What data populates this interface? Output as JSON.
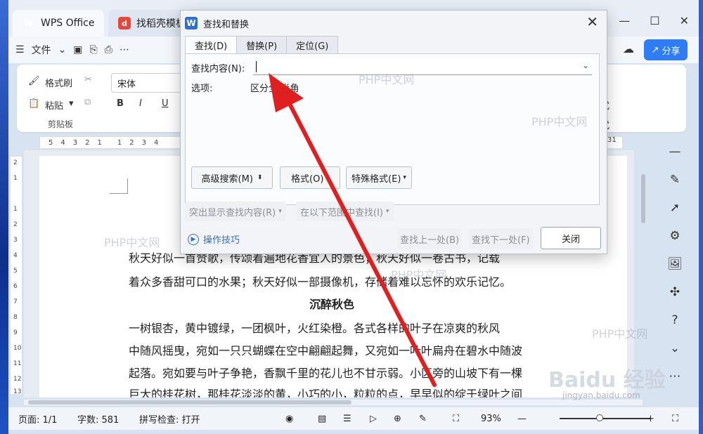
{
  "titlebar": {
    "tabs": [
      {
        "label": "WPS Office"
      },
      {
        "label": "找稻壳模板"
      }
    ],
    "share_label": "分享"
  },
  "toolbar": {
    "file_menu": "文件"
  },
  "ribbon": {
    "format_painter": "格式刷",
    "paste": "粘贴",
    "clipboard_group": "剪贴板",
    "font_name": "宋体",
    "bold": "B",
    "italic": "I",
    "underline": "U"
  },
  "ruler": {
    "ticks": [
      "5",
      "4",
      "3",
      "2",
      "1",
      "",
      "1",
      "2",
      "3",
      "4"
    ],
    "right_tick": "31",
    "vticks": [
      "2",
      "1",
      "",
      "1",
      "2",
      "3",
      "4",
      "5",
      "6",
      "7",
      "8",
      "9",
      "10",
      "11",
      "12",
      "13"
    ]
  },
  "document": {
    "para1_line1": "秋天好似一首赞歌，传颂着遍地花香宜人的景色；秋天好似一卷古书，记载",
    "para1_line2": "着众多香甜可口的水果；秋天好似一部摄像机，存储着难以忘怀的欢乐记忆。",
    "heading": "沉醉秋色",
    "para2_line1": "一树银杏，黄中镀绿，一团枫叶，火红染橙。各式各样的叶子在凉爽的秋风",
    "para2_line2": "中随风摇曳，宛如一只只蝴蝶在空中翩翩起舞，又宛如一叶叶扁舟在碧水中随波",
    "para2_line3": "起落。宛如要与叶子争艳，香飘千里的花儿也不甘示弱。小区旁的山坡下有一棵",
    "para2_line4": "巨大的桂花树，那桂花淡淡的黄，小巧的小，粒粒的点，早早似的绽于绿叶之间"
  },
  "dialog": {
    "title": "查找和替换",
    "tabs": [
      "查找(D)",
      "替换(P)",
      "定位(G)"
    ],
    "find_label": "查找内容(N):",
    "find_value": "",
    "options_label": "选项:",
    "options_value": "区分全/半角",
    "advanced_search": "高级搜索(M)",
    "format": "格式(O)",
    "special_format": "特殊格式(E)",
    "highlight": "突出显示查找内容(R)",
    "find_in": "在以下范围中查找(I)",
    "tips": "操作技巧",
    "find_prev": "查找上一处(B)",
    "find_next": "查找下一处(F)",
    "close": "关闭"
  },
  "statusbar": {
    "page": "页面: 1/1",
    "words": "字数: 581",
    "spell": "拼写检查: 打开",
    "zoom": "93%"
  },
  "watermarks": {
    "php": "PHP中文网",
    "baidu": "Baidu 经验",
    "baidu_url": "jingyan.baidu.com"
  },
  "colors": {
    "accent": "#2e7cf6",
    "arrow": "#e02020",
    "dialog_bg": "#f3f4f7"
  }
}
